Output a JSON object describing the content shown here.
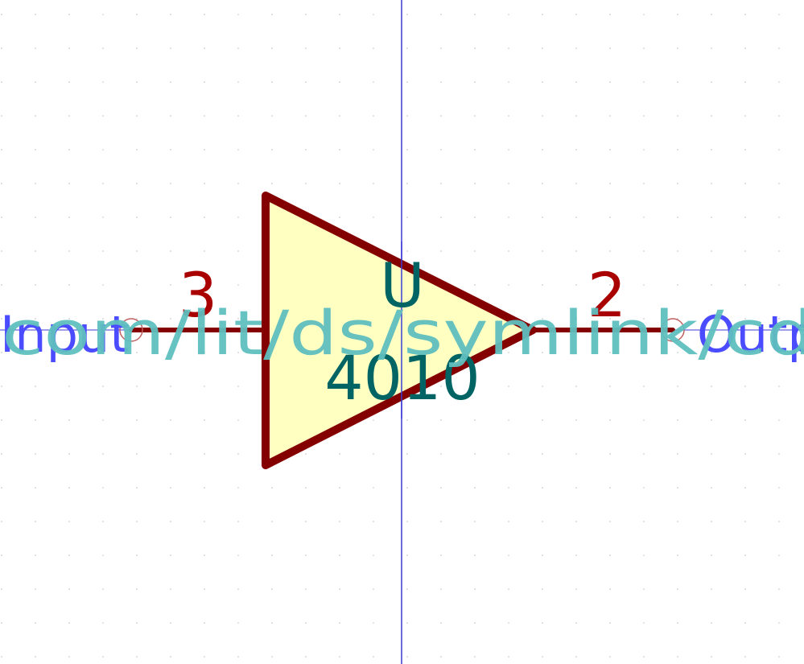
{
  "symbol": {
    "reference": "U",
    "value": "4010",
    "datasheet_url": "com/lit/ds/symlink/cd",
    "colors": {
      "body_fill": "#ffffc2",
      "body_outline": "#840000",
      "pin_line": "#840000",
      "pin_number": "#a90000",
      "pin_name": "#4b4bff",
      "field_text": "#006464",
      "datasheet_text": "#5fbfbf",
      "axis_line": "#3b3bd6",
      "pin_endpoint": "#c06060",
      "grid_dot": "#d8d8d8"
    }
  },
  "pins": [
    {
      "number": "3",
      "name": "Input",
      "side": "left"
    },
    {
      "number": "2",
      "name": "Output",
      "side": "right"
    }
  ]
}
